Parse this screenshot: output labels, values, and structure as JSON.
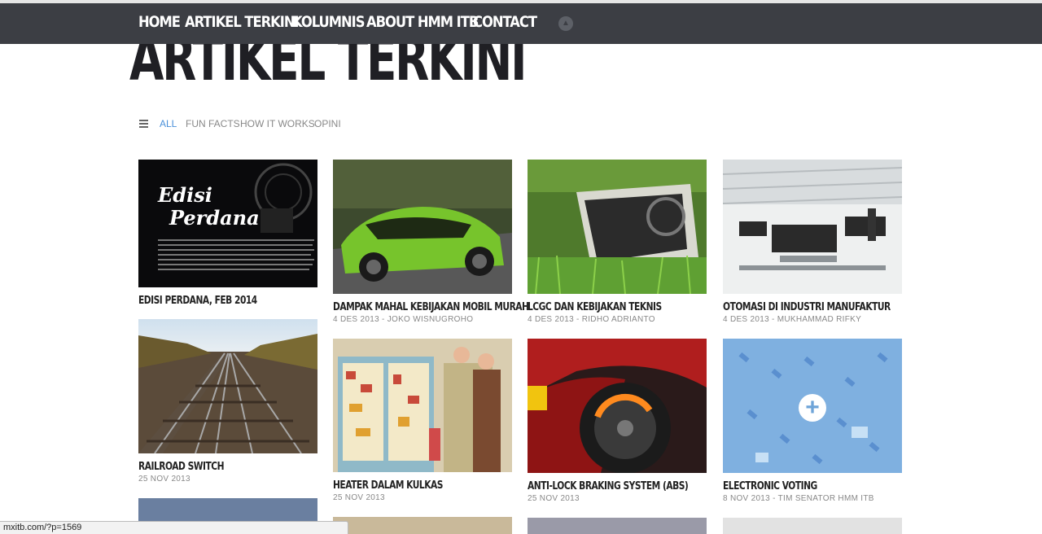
{
  "nav": {
    "items": [
      "HOME",
      "ARTIKEL TERKINI",
      "KOLUMNIS",
      "ABOUT HMM ITB",
      "CONTACT"
    ]
  },
  "page": {
    "title": "ARTIKEL TERKINI"
  },
  "filters": {
    "items": [
      "ALL",
      "FUN FACTS",
      "HOW IT WORKS",
      "OPINI"
    ],
    "active": "ALL"
  },
  "articles": [
    {
      "title": "EDISI PERDANA, FEB 2014",
      "meta": "",
      "image_text": [
        "Edisi",
        "Perdana"
      ]
    },
    {
      "title": "DAMPAK MAHAL KEBIJAKAN MOBIL MURAH",
      "meta": "4 DES 2013 - JOKO WISNUGROHO"
    },
    {
      "title": "LCGC DAN KEBIJAKAN TEKNIS",
      "meta": "4 DES 2013 - RIDHO ADRIANTO"
    },
    {
      "title": "OTOMASI DI INDUSTRI MANUFAKTUR",
      "meta": "4 DES 2013 - MUKHAMMAD RIFKY"
    },
    {
      "title": "RAILROAD SWITCH",
      "meta": "25 NOV 2013"
    },
    {
      "title": "HEATER DALAM KULKAS",
      "meta": "25 NOV 2013"
    },
    {
      "title": "ANTI-LOCK BRAKING SYSTEM (ABS)",
      "meta": "25 NOV 2013"
    },
    {
      "title": "ELECTRONIC VOTING",
      "meta": "8 NOV 2013 - TIM SENATOR HMM ITB"
    }
  ],
  "statusbar": {
    "url": "mxitb.com/?p=1569"
  },
  "colors": {
    "nav_bg": "#3c3e44",
    "accent": "#4a90d9",
    "title": "#1f1f24"
  }
}
